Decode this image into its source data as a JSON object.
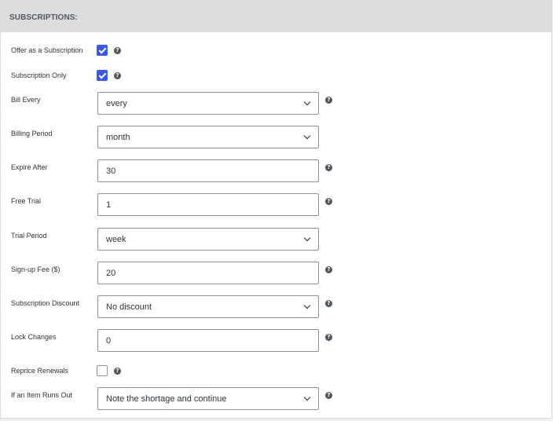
{
  "section": {
    "title": "SUBSCRIPTIONS:"
  },
  "help_glyph": "?",
  "colors": {
    "checkbox_checked": "#3858e9",
    "header_bg": "#dcdcde"
  },
  "fields": {
    "offer_subscription": {
      "label": "Offer as a Subscription",
      "checked": true
    },
    "subscription_only": {
      "label": "Subscription Only",
      "checked": true
    },
    "bill_every": {
      "label": "Bill Every",
      "value": "every"
    },
    "billing_period": {
      "label": "Billing Period",
      "value": "month"
    },
    "expire_after": {
      "label": "Expire After",
      "value": "30"
    },
    "free_trial": {
      "label": "Free Trial",
      "value": "1"
    },
    "trial_period": {
      "label": "Trial Period",
      "value": "week"
    },
    "signup_fee": {
      "label": "Sign-up Fee ($)",
      "value": "20"
    },
    "subscription_discount": {
      "label": "Subscription Discount",
      "value": "No discount"
    },
    "lock_changes": {
      "label": "Lock Changes",
      "value": "0"
    },
    "reprice_renewals": {
      "label": "Reprice Renewals",
      "checked": false
    },
    "item_runs_out": {
      "label": "If an Item Runs Out",
      "value": "Note the shortage and continue"
    }
  }
}
